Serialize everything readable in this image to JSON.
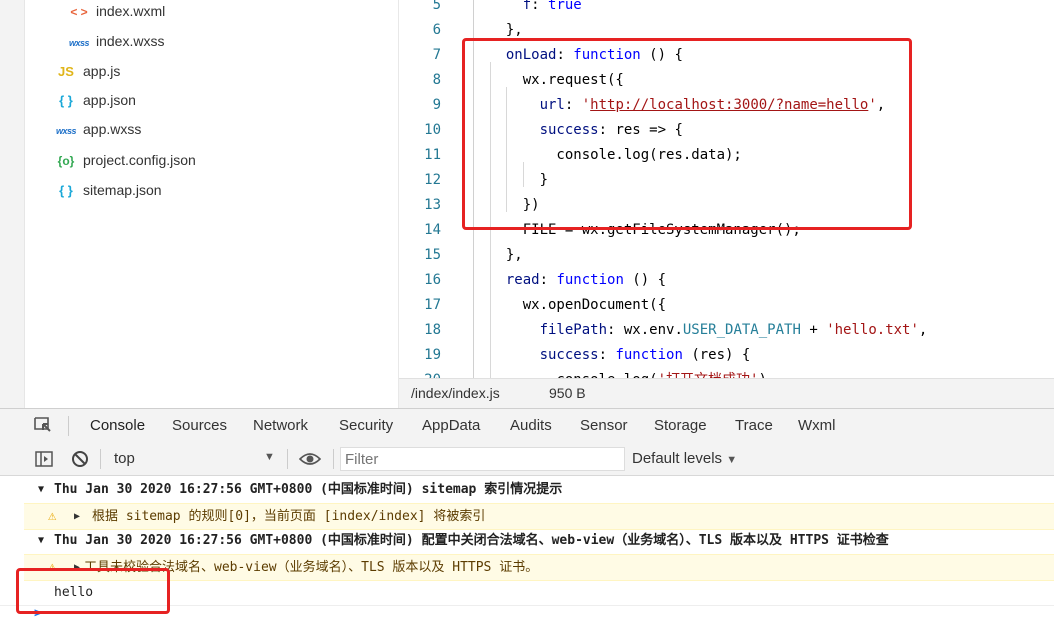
{
  "file_tree": [
    {
      "icon": "< >",
      "label": "index.wxml",
      "indent": true,
      "kind": "xml"
    },
    {
      "icon": "wxss",
      "label": "index.wxss",
      "indent": true,
      "kind": "wxss"
    },
    {
      "icon": "JS",
      "label": "app.js",
      "indent": false,
      "kind": "js"
    },
    {
      "icon": "{ }",
      "label": "app.json",
      "indent": false,
      "kind": "json"
    },
    {
      "icon": "wxss",
      "label": "app.wxss",
      "indent": false,
      "kind": "wxss"
    },
    {
      "icon": "{o}",
      "label": "project.config.json",
      "indent": false,
      "kind": "cfg"
    },
    {
      "icon": "{ }",
      "label": "sitemap.json",
      "indent": false,
      "kind": "json"
    }
  ],
  "editor": {
    "lines": [
      {
        "n": "5",
        "html": "    <span class='prop'>f</span>: <span class='kw'>true</span>"
      },
      {
        "n": "6",
        "html": "  },"
      },
      {
        "n": "7",
        "html": "  <span class='prop'>onLoad</span>: <span class='kw'>function</span> () {"
      },
      {
        "n": "8",
        "html": "    wx.request({"
      },
      {
        "n": "9",
        "html": "      <span class='prop'>url</span>: <span class='str'>'<u>http://localhost:3000/?name=hello</u>'</span>,"
      },
      {
        "n": "10",
        "html": "      <span class='prop'>success</span>: res => {"
      },
      {
        "n": "11",
        "html": "        console.log(res.data);"
      },
      {
        "n": "12",
        "html": "      }"
      },
      {
        "n": "13",
        "html": "    })"
      },
      {
        "n": "14",
        "html": "    FILE = wx.getFileSystemManager();"
      },
      {
        "n": "15",
        "html": "  },"
      },
      {
        "n": "16",
        "html": "  <span class='prop'>read</span>: <span class='kw'>function</span> () {"
      },
      {
        "n": "17",
        "html": "    wx.openDocument({"
      },
      {
        "n": "18",
        "html": "      <span class='prop'>filePath</span>: wx.env.<span class='const'>USER_DATA_PATH</span> + <span class='str'>'hello.txt'</span>,"
      },
      {
        "n": "19",
        "html": "      <span class='prop'>success</span>: <span class='kw'>function</span> (res) {"
      },
      {
        "n": "20",
        "html": "        console.log(<span class='str'>'打开文档成功'</span>)"
      }
    ]
  },
  "status": {
    "path": "/index/index.js",
    "size": "950 B"
  },
  "devtools": {
    "tabs": [
      "Console",
      "Sources",
      "Network",
      "Security",
      "AppData",
      "Audits",
      "Sensor",
      "Storage",
      "Trace",
      "Wxml"
    ],
    "active_tab": "Console",
    "context": "top",
    "filter_placeholder": "Filter",
    "levels": "Default levels"
  },
  "console": {
    "group1_title": "Thu Jan 30 2020 16:27:56 GMT+0800 (中国标准时间) sitemap 索引情况提示",
    "warn1": "根据 sitemap 的规则[0]，当前页面 [index/index] 将被索引",
    "group2_title": "Thu Jan 30 2020 16:27:56 GMT+0800 (中国标准时间) 配置中关闭合法域名、web-view（业务域名）、TLS 版本以及 HTTPS 证书检查",
    "warn2": "工具未校验合法域名、web-view（业务域名）、TLS 版本以及 HTTPS 证书。",
    "output": "hello",
    "prompt": ">"
  },
  "colors": {
    "highlight_box": "#e62222",
    "accent": "#1a73e8",
    "warning_bg": "#fffbe5"
  }
}
